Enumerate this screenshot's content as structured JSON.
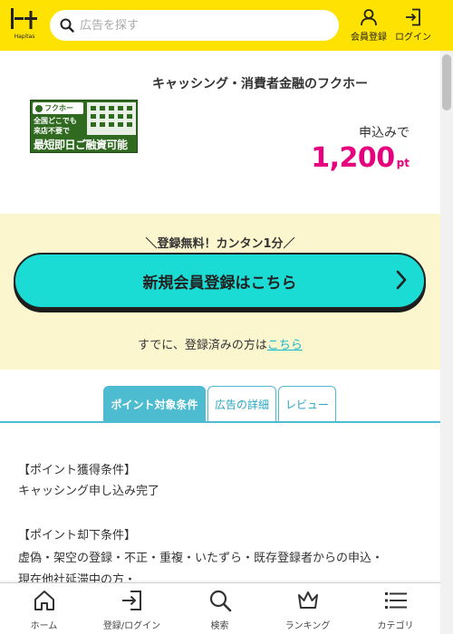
{
  "header": {
    "logo_text": "Hapitas",
    "search_placeholder": "広告を探す",
    "register_label": "会員登録",
    "login_label": "ログイン",
    "background_color": "#fde202"
  },
  "ad": {
    "title": "キャッシング・消費者金融のフクホー",
    "banner": {
      "brand": "フクホー",
      "line1": "全国どこでも",
      "line2": "来店不要で",
      "line3": "最短即日ご融資可能"
    },
    "apply_label": "申込みで",
    "points_value": "1,200",
    "points_unit": "pt",
    "points_color": "#e6007e"
  },
  "registration": {
    "note": "＼登録無料！カンタン1分／",
    "button_label": "新規会員登録はこちら",
    "login_prefix": "すでに、登録済みの方は",
    "login_link": "こちら",
    "button_color": "#1bdcd4"
  },
  "tabs": [
    {
      "label": "ポイント対象条件",
      "active": true
    },
    {
      "label": "広告の詳細",
      "active": false
    },
    {
      "label": "レビュー",
      "active": false
    }
  ],
  "conditions": {
    "earn_heading": "【ポイント獲得条件】",
    "earn_text": "キャッシング申し込み完了",
    "reject_heading": "【ポイント却下条件】",
    "reject_text_1": "虚偽・架空の登録・不正・重複・いたずら・既存登録者からの申込・",
    "reject_text_2": "現在他社延滞中の方・"
  },
  "bottom_nav": [
    {
      "label": "ホーム",
      "icon": "home-icon"
    },
    {
      "label": "登録/ログイン",
      "icon": "login-icon"
    },
    {
      "label": "検索",
      "icon": "search-icon"
    },
    {
      "label": "ランキング",
      "icon": "crown-icon"
    },
    {
      "label": "カテゴリ",
      "icon": "list-icon"
    }
  ]
}
